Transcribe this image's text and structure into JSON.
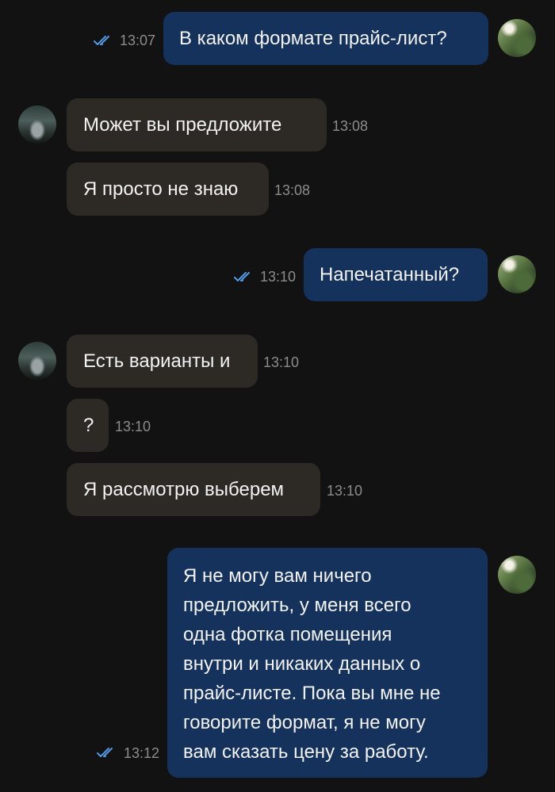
{
  "colors": {
    "background": "#121212",
    "incoming_bubble": "#2d2a25",
    "outgoing_bubble": "#14325c",
    "timestamp": "#8c8c8c",
    "read_ticks": "#4f9be8"
  },
  "messages": [
    {
      "direction": "out",
      "text": "В каком формате прайс-лист?",
      "time": "13:07",
      "read_icon": "double-check-icon"
    },
    {
      "direction": "in",
      "text": "Может вы предложите",
      "time": "13:08"
    },
    {
      "direction": "in",
      "text": "Я просто не знаю",
      "time": "13:08"
    },
    {
      "direction": "out",
      "text": "Напечатанный?",
      "time": "13:10",
      "read_icon": "double-check-icon"
    },
    {
      "direction": "in",
      "text": "Есть варианты и",
      "time": "13:10"
    },
    {
      "direction": "in",
      "text": "?",
      "time": "13:10"
    },
    {
      "direction": "in",
      "text": "Я рассмотрю выберем",
      "time": "13:10"
    },
    {
      "direction": "out",
      "lines": [
        "Я не могу вам ничего",
        "предложить, у меня всего",
        "одна фотка помещения",
        "внутри и никаких данных о",
        "прайс-листе. Пока вы мне не",
        "говорите формат, я не могу",
        "вам сказать цену за работу."
      ],
      "time": "13:12",
      "read_icon": "double-check-icon"
    }
  ]
}
